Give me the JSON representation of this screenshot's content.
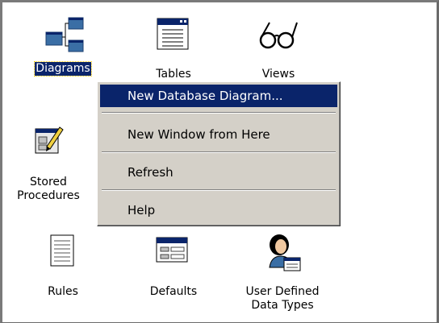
{
  "icons": [
    {
      "id": "diagrams",
      "label": "Diagrams",
      "icon": "diagram-icon",
      "selected": true
    },
    {
      "id": "tables",
      "label": "Tables",
      "icon": "table-icon"
    },
    {
      "id": "views",
      "label": "Views",
      "icon": "glasses-icon"
    },
    {
      "id": "stored-procedures",
      "label_line1": "Stored",
      "label_line2": "Procedures",
      "icon": "stored-procedure-icon"
    },
    {
      "id": "rules",
      "label": "Rules",
      "icon": "rule-document-icon"
    },
    {
      "id": "defaults",
      "label": "Defaults",
      "icon": "default-form-icon"
    },
    {
      "id": "user-defined-data-types",
      "label_line1": "User Defined",
      "label_line2": "Data Types",
      "icon": "user-type-icon"
    }
  ],
  "context_menu": {
    "items": [
      {
        "label": "New Database Diagram...",
        "highlighted": true
      },
      {
        "label": "New Window from Here"
      },
      {
        "label": "Refresh"
      },
      {
        "label": "Help"
      }
    ]
  },
  "colors": {
    "selection": "#0a246a",
    "menu_bg": "#d4d0c8",
    "window_border": "#7a7a7a"
  }
}
